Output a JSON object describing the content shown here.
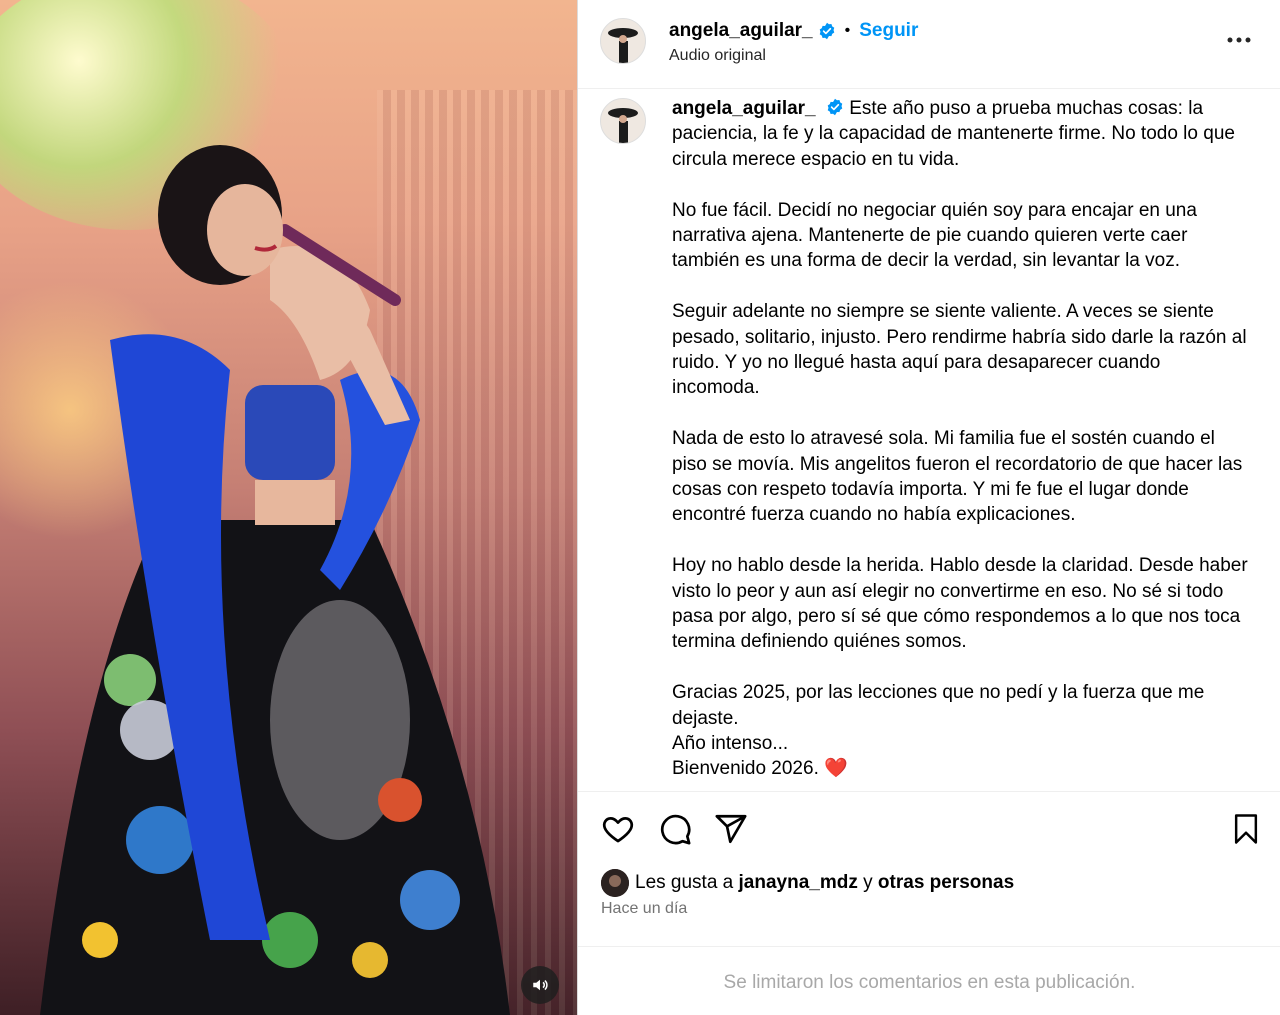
{
  "post": {
    "username": "angela_aguilar_",
    "follow_label": "Seguir",
    "separator": "•",
    "audio_label": "Audio original",
    "caption_paragraphs": [
      "Este año puso a prueba muchas cosas: la paciencia, la fe y la capacidad de mantenerte firme. No todo lo que circula merece espacio en tu vida.",
      "No fue fácil. Decidí no negociar quién soy para encajar en una narrativa ajena. Mantenerte de pie cuando quieren verte caer también es una forma de decir la verdad, sin levantar la voz.",
      "Seguir adelante no siempre se siente valiente. A veces se siente pesado, solitario, injusto. Pero rendirme habría sido darle la razón al ruido. Y yo no llegué hasta aquí para desaparecer cuando incomoda.",
      "Nada de esto lo atravesé sola. Mi familia fue el sostén cuando el piso se movía. Mis angelitos fueron el recordatorio de que hacer las cosas con respeto todavía importa. Y mi fe fue el lugar donde encontré fuerza cuando no había explicaciones.",
      "Hoy no hablo desde la herida. Hablo desde la claridad. Desde haber visto lo peor y aun así elegir no convertirme en eso. No sé si todo pasa por algo, pero sí sé que cómo respondemos a lo que nos toca termina definiendo quiénes somos."
    ],
    "caption_closing": {
      "line1": "Gracias 2025, por las lecciones que no pedí y la fuerza que me dejaste.",
      "line2": "Año intenso...",
      "line3": "Bienvenido 2026. ",
      "heart": "❤️"
    },
    "likes": {
      "prefix": "Les gusta a ",
      "user": "janayna_mdz",
      "middle": " y ",
      "others": "otras personas"
    },
    "time_ago": "Hace un día",
    "comments_limited": "Se limitaron los comentarios en esta publicación."
  },
  "icons": {
    "verified": "verified-badge-icon",
    "more": "more-options-icon",
    "like": "heart-icon",
    "comment": "comment-icon",
    "share": "share-icon",
    "save": "bookmark-icon",
    "sound": "speaker-icon"
  },
  "colors": {
    "accent": "#0095f6",
    "heart": "#ed4956",
    "muted": "#737373",
    "disabled": "#a8a8a8"
  }
}
